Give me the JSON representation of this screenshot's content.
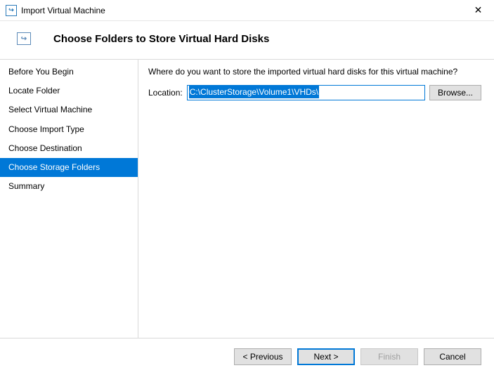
{
  "window": {
    "title": "Import Virtual Machine"
  },
  "banner": {
    "title": "Choose Folders to Store Virtual Hard Disks"
  },
  "steps": [
    {
      "label": "Before You Begin",
      "selected": false
    },
    {
      "label": "Locate Folder",
      "selected": false
    },
    {
      "label": "Select Virtual Machine",
      "selected": false
    },
    {
      "label": "Choose Import Type",
      "selected": false
    },
    {
      "label": "Choose Destination",
      "selected": false
    },
    {
      "label": "Choose Storage Folders",
      "selected": true
    },
    {
      "label": "Summary",
      "selected": false
    }
  ],
  "content": {
    "prompt": "Where do you want to store the imported virtual hard disks for this virtual machine?",
    "location_label": "Location:",
    "location_value": "C:\\ClusterStorage\\Volume1\\VHDs\\",
    "browse_label": "Browse..."
  },
  "footer": {
    "previous": "< Previous",
    "next": "Next >",
    "finish": "Finish",
    "cancel": "Cancel"
  }
}
